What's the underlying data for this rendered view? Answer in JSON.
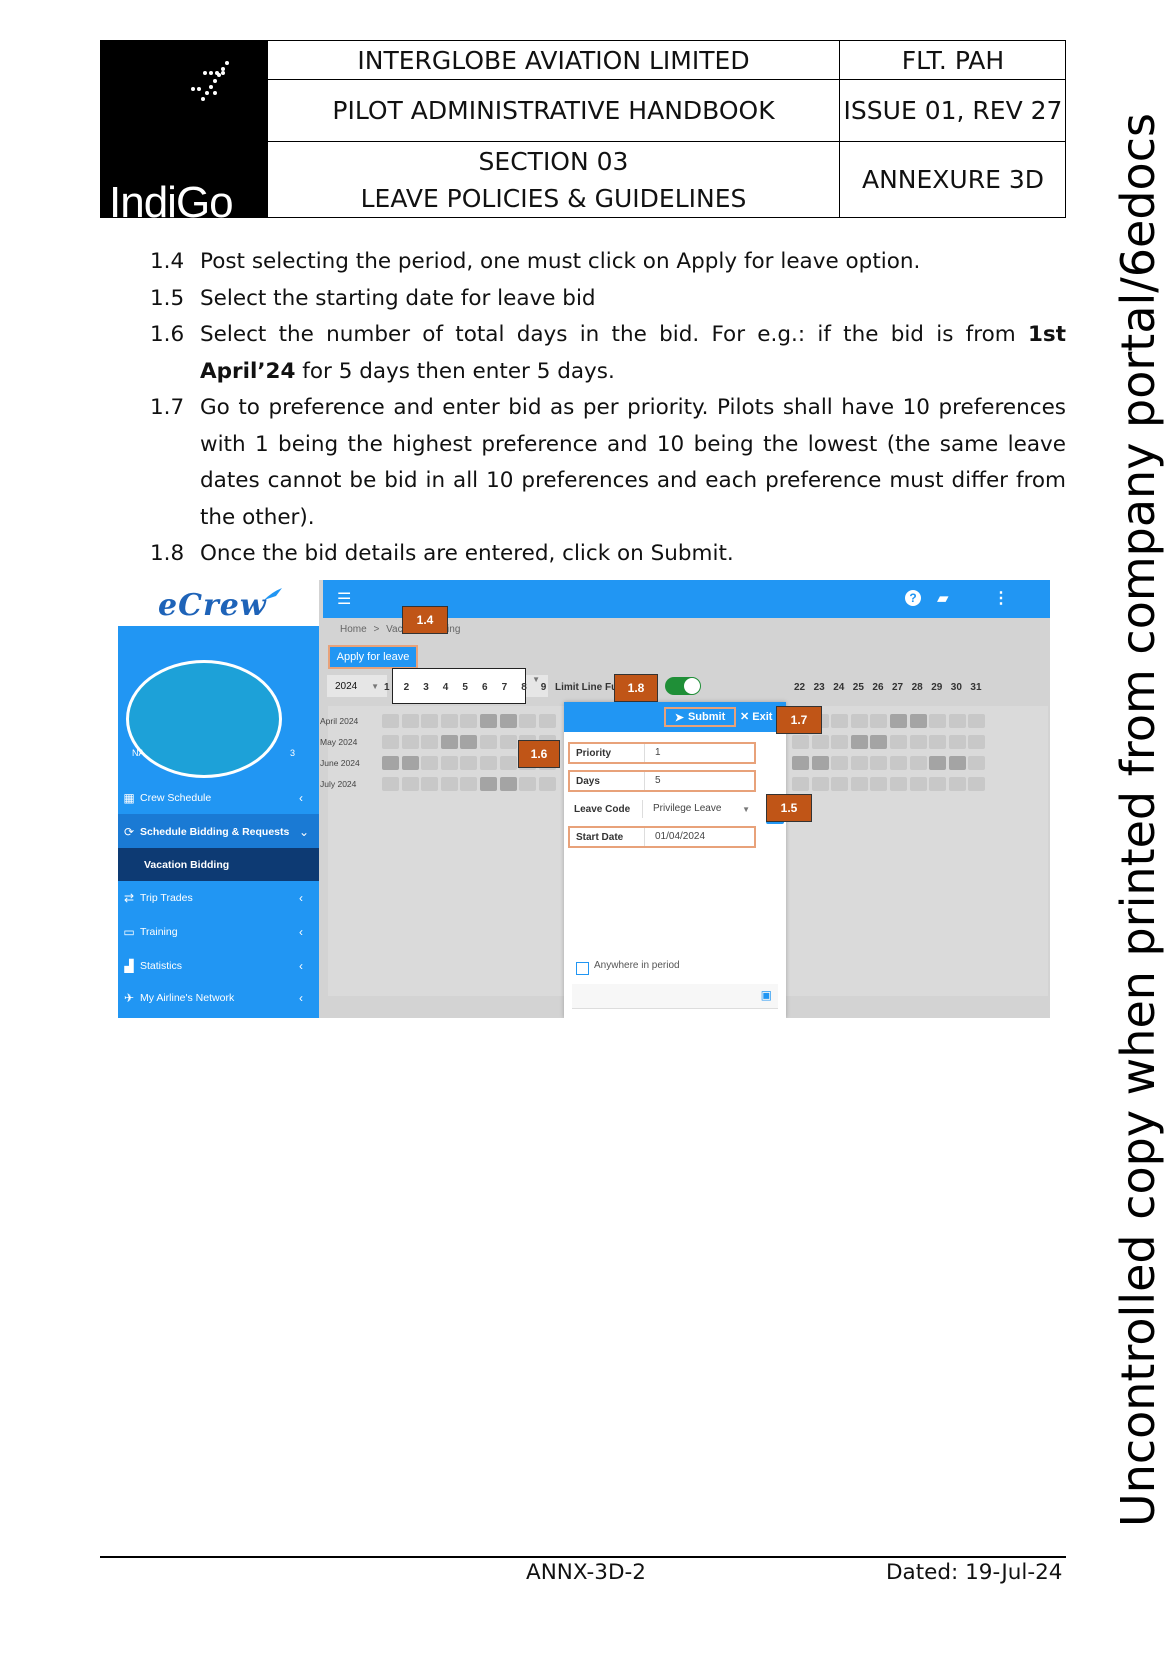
{
  "header": {
    "logo_text": "IndiGo",
    "company": "INTERGLOBE AVIATION LIMITED",
    "handbook": "PILOT ADMINISTRATIVE HANDBOOK",
    "section_line1": "SECTION 03",
    "section_line2": "LEAVE POLICIES & GUIDELINES",
    "doc_code": "FLT. PAH",
    "issue": "ISSUE 01, REV 27",
    "annexure": "ANNEXURE 3D"
  },
  "steps": [
    {
      "num": "1.4",
      "text": "Post selecting the period, one must click on Apply for leave option."
    },
    {
      "num": "1.5",
      "text": "Select the starting date for leave bid"
    },
    {
      "num": "1.6",
      "text_before": "Select the number of total days in the bid. For e.g.: if the bid is from ",
      "bold": "1st April’24",
      "text_after": " for 5 days then enter 5 days."
    },
    {
      "num": "1.7",
      "text": "Go to preference and enter bid as per priority. Pilots shall have 10 preferences with 1 being the highest preference and 10 being the lowest (the same leave dates cannot be bid in all 10 preferences and each preference must differ from the other)."
    },
    {
      "num": "1.8",
      "text": "Once the bid details are entered, click on Submit."
    }
  ],
  "screenshot": {
    "brand": "eCrew",
    "nav_initials_left": "NA",
    "nav_initials_right": "3",
    "menu": [
      {
        "label": "Crew Schedule",
        "icon": "calendar-icon"
      },
      {
        "label": "Schedule Bidding & Requests",
        "icon": "bidding-icon"
      },
      {
        "label": "Vacation Bidding",
        "icon": ""
      },
      {
        "label": "Trip Trades",
        "icon": "trade-icon"
      },
      {
        "label": "Training",
        "icon": "training-icon"
      },
      {
        "label": "Statistics",
        "icon": "chart-icon"
      },
      {
        "label": "My Airline's Network",
        "icon": "plane-icon"
      }
    ],
    "breadcrumb_home": "Home",
    "breadcrumb_sep": ">",
    "breadcrumb_page": "Vacation Bidding",
    "apply_label": "Apply for leave",
    "year": "2024",
    "limit_label": "Limit Line Full Days",
    "toggle_on": true,
    "days_left": [
      "1",
      "2",
      "3",
      "4",
      "5",
      "6",
      "7",
      "8",
      "9"
    ],
    "days_right": [
      "22",
      "23",
      "24",
      "25",
      "26",
      "27",
      "28",
      "29",
      "30",
      "31"
    ],
    "months": [
      "April 2024",
      "May 2024",
      "June 2024",
      "July 2024"
    ],
    "modal": {
      "submit": "Submit",
      "exit": "Exit",
      "priority_label": "Priority",
      "priority_value": "1",
      "days_label": "Days",
      "days_value": "5",
      "leave_code_label": "Leave Code",
      "leave_code_value": "Privilege Leave",
      "start_date_label": "Start Date",
      "start_date_value": "01/04/2024",
      "anywhere_label": "Anywhere in period"
    },
    "badges": {
      "b14": "1.4",
      "b15": "1.5",
      "b16": "1.6",
      "b17": "1.7",
      "b18": "1.8"
    },
    "accent": "#2196f3",
    "badge_color": "#c05517"
  },
  "footer": {
    "code": "ANNX-3D-2",
    "dated": "Dated: 19-Jul-24"
  },
  "watermark": "Uncontrolled copy when printed from company portal/6edocs"
}
